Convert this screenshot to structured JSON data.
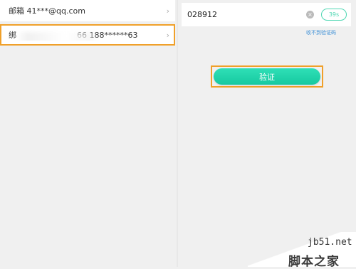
{
  "accounts": {
    "email_label": "邮箱 41***@qq.com",
    "phone_prefix": "绑",
    "phone_label": "66 188******63",
    "chevron": "›"
  },
  "verification": {
    "code_value": "028912",
    "clear_glyph": "×",
    "countdown": "39s",
    "no_code_link": "收不到验证码",
    "verify_button": "验证"
  },
  "watermark": {
    "site": "jb51.net",
    "name": "脚本之家"
  },
  "colors": {
    "accent_green": "#1fd3a9",
    "highlight_orange": "#f0a02a",
    "link_blue": "#3c8fd6"
  }
}
